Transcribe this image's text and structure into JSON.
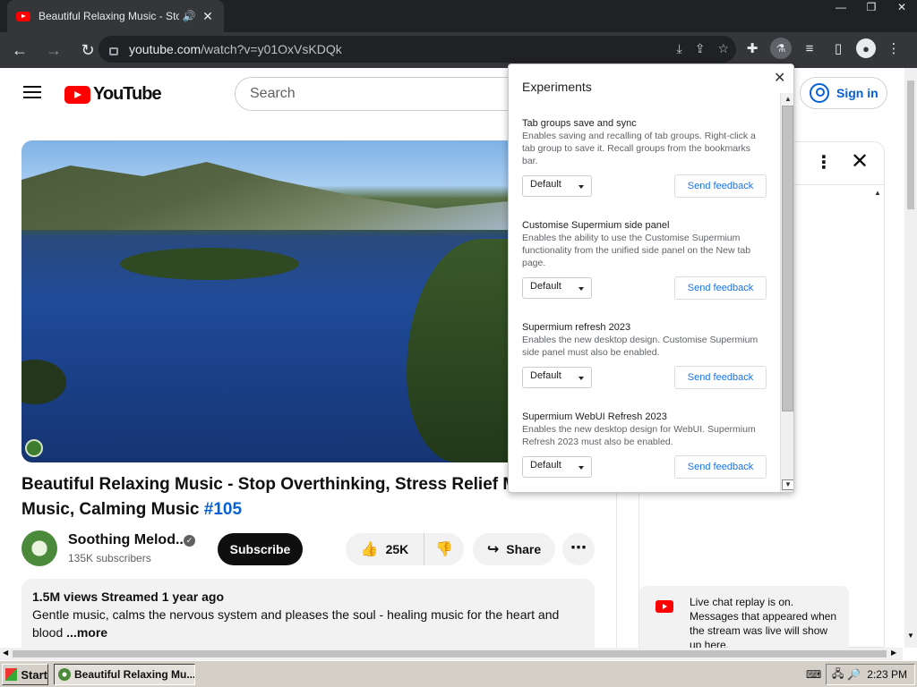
{
  "browser": {
    "tab_title": "Beautiful Relaxing Music - Stop Overthinking",
    "url_host": "youtube.com",
    "url_path": "/watch?v=y01OxVsKDQk"
  },
  "youtube": {
    "logo_text": "YouTube",
    "search_placeholder": "Search",
    "signin_label": "Sign in"
  },
  "video": {
    "title": "Beautiful Relaxing Music - Stop Overthinking, Stress Relief Music, Sleep Music, Calming Music",
    "hashtag": "#105",
    "channel_name": "Soothing Melod...",
    "subscribers": "135K subscribers",
    "subscribe_label": "Subscribe",
    "likes": "25K",
    "share_label": "Share",
    "views_meta": "1.5M views  Streamed 1 year ago",
    "description": "Gentle music, calms the nervous system and pleases the soul - healing music for the heart and blood",
    "more_label": "...more"
  },
  "chat": {
    "replay_text": "Live chat replay is on. Messages that appeared when the stream was live will show up here."
  },
  "experiments": {
    "title": "Experiments",
    "flags": [
      {
        "name": "Tab groups save and sync",
        "description": "Enables saving and recalling of tab groups. Right-click a tab group to save it. Recall groups from the bookmarks bar.",
        "value": "Default",
        "feedback": "Send feedback"
      },
      {
        "name": "Customise Supermium side panel",
        "description": "Enables the ability to use the Customise Supermium functionality from the unified side panel on the New tab page.",
        "value": "Default",
        "feedback": "Send feedback"
      },
      {
        "name": "Supermium refresh 2023",
        "description": "Enables the new desktop design. Customise Supermium side panel must also be enabled.",
        "value": "Default",
        "feedback": "Send feedback"
      },
      {
        "name": "Supermium WebUI Refresh 2023",
        "description": "Enables the new desktop design for WebUI. Supermium Refresh 2023 must also be enabled.",
        "value": "Default",
        "feedback": "Send feedback"
      }
    ]
  },
  "taskbar": {
    "start_label": "Start",
    "task_label": "Beautiful Relaxing Mu...",
    "clock": "2:23 PM"
  }
}
